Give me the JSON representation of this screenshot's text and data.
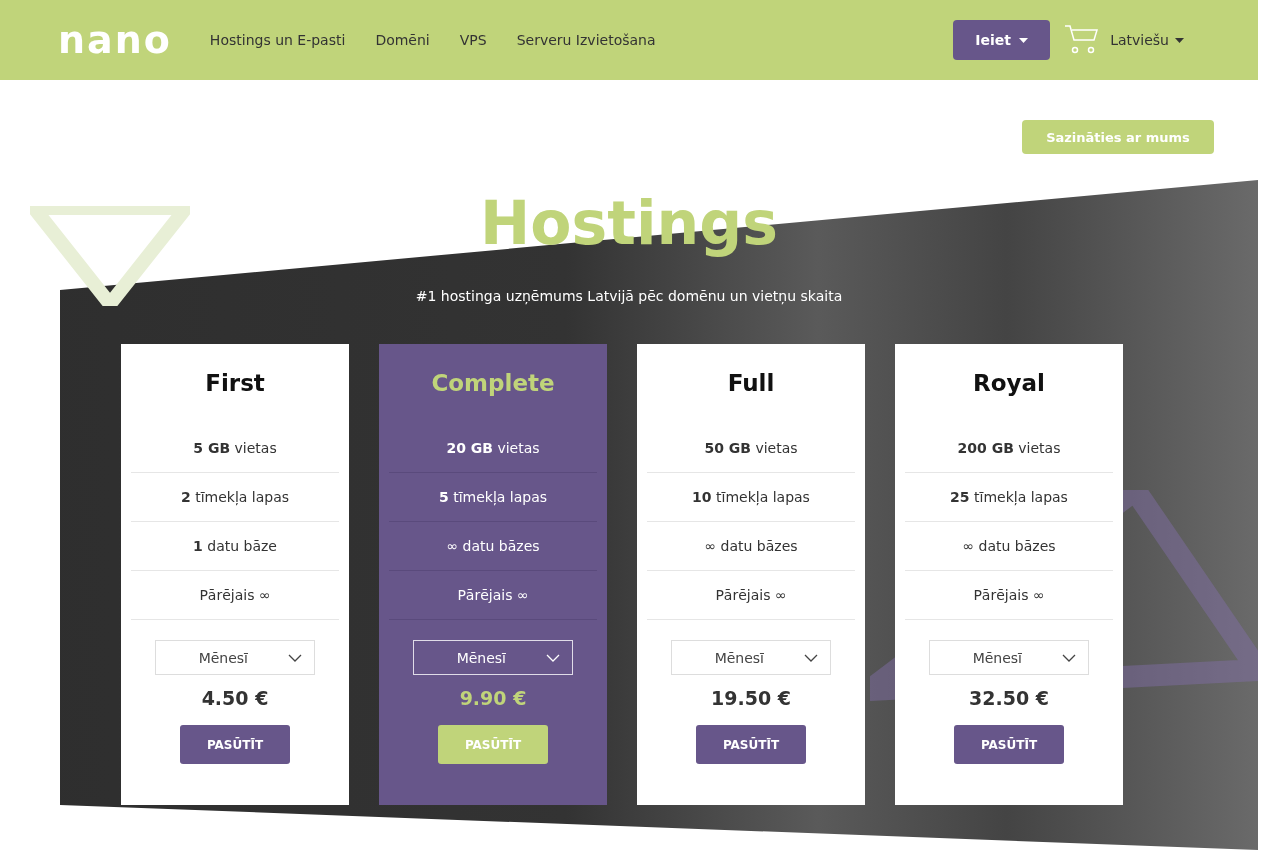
{
  "header": {
    "logo": "nano",
    "nav": [
      "Hostings un E-pasti",
      "Domēni",
      "VPS",
      "Serveru Izvietošana"
    ],
    "login_button": "Ieiet",
    "language": "Latviešu"
  },
  "contact_button": "Sazināties ar mums",
  "hero": {
    "title": "Hostings",
    "subtitle": "#1 hostinga uzņēmums Latvijā pēc domēnu un vietņu skaita"
  },
  "plans": [
    {
      "name": "First",
      "highlighted": false,
      "features": [
        "**5 GB** vietas",
        "**2** tīmekļa lapas",
        "**1** datu bāze",
        "Pārējais ∞"
      ],
      "period": "Mēnesī",
      "price": "4.50 €",
      "order_button": "PASŪTĪT"
    },
    {
      "name": "Complete",
      "highlighted": true,
      "features": [
        "**20 GB** vietas",
        "**5** tīmekļa lapas",
        "∞ datu bāzes",
        "Pārējais ∞"
      ],
      "period": "Mēnesī",
      "price": "9.90 €",
      "order_button": "PASŪTĪT"
    },
    {
      "name": "Full",
      "highlighted": false,
      "features": [
        "**50 GB** vietas",
        "**10** tīmekļa lapas",
        "∞ datu bāzes",
        "Pārējais ∞"
      ],
      "period": "Mēnesī",
      "price": "19.50 €",
      "order_button": "PASŪTĪT"
    },
    {
      "name": "Royal",
      "highlighted": false,
      "features": [
        "**200 GB** vietas",
        "**25** tīmekļa lapas",
        "∞ datu bāzes",
        "Pārējais ∞"
      ],
      "period": "Mēnesī",
      "price": "32.50 €",
      "order_button": "PASŪTĪT"
    }
  ]
}
